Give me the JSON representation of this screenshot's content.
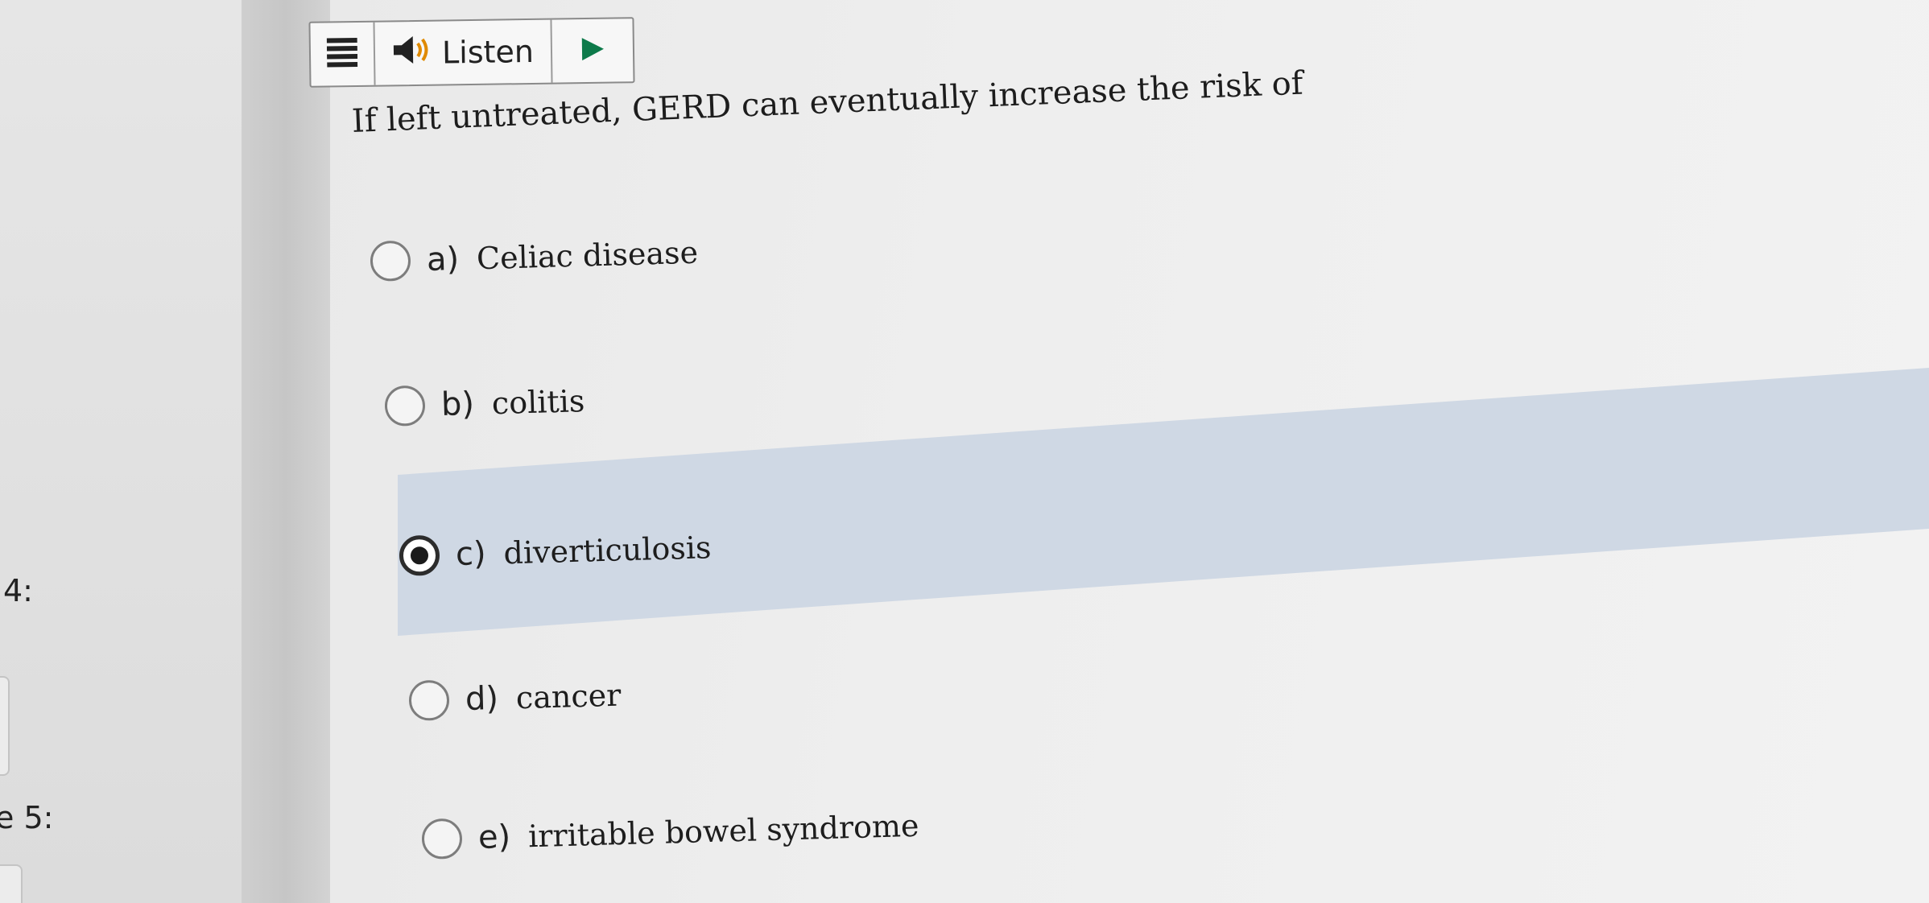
{
  "sidebar": {
    "items": [
      {
        "label": "4:"
      },
      {
        "label": "e 5:"
      }
    ]
  },
  "toolbar": {
    "menu_icon": "hamburger-menu-icon",
    "speaker_icon": "speaker-icon",
    "listen_label": "Listen",
    "play_icon": "play-icon"
  },
  "question": {
    "text": "If left untreated, GERD can eventually increase the risk of",
    "options": [
      {
        "letter": "a)",
        "text": "Celiac disease",
        "selected": false
      },
      {
        "letter": "b)",
        "text": "colitis",
        "selected": false
      },
      {
        "letter": "c)",
        "text": "diverticulosis",
        "selected": true
      },
      {
        "letter": "d)",
        "text": "cancer",
        "selected": false
      },
      {
        "letter": "e)",
        "text": "irritable bowel syndrome",
        "selected": false
      }
    ]
  },
  "colors": {
    "selected_highlight": "#cfd8e4",
    "text": "#1d1d1d"
  }
}
